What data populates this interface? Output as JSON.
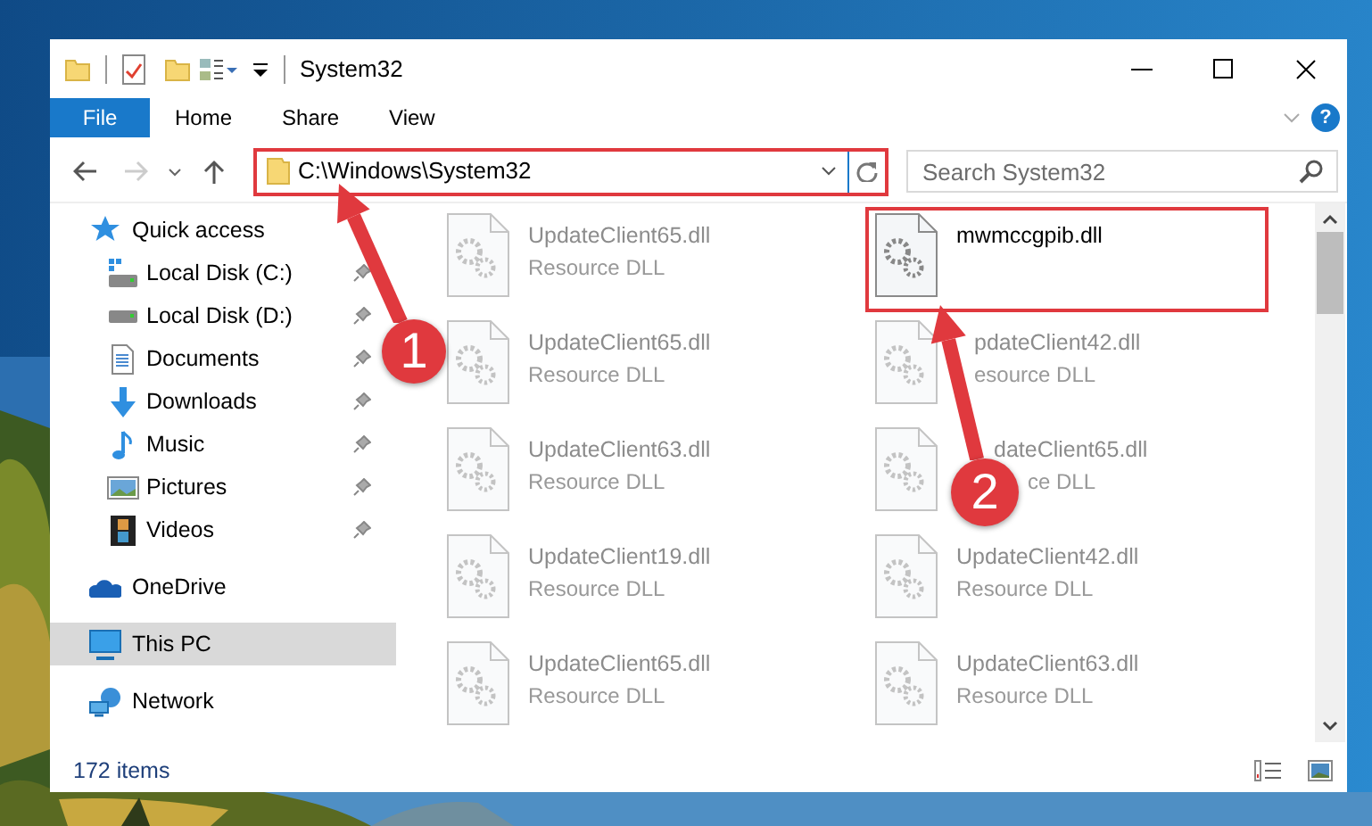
{
  "window": {
    "title": "System32"
  },
  "ribbon": {
    "file_button": "File",
    "tabs": [
      "Home",
      "Share",
      "View"
    ],
    "help": "?"
  },
  "navigation": {
    "back_enabled": true,
    "forward_enabled": false
  },
  "address_bar": {
    "path": "C:\\Windows\\System32",
    "highlighted": true
  },
  "search": {
    "placeholder": "Search System32"
  },
  "sidebar": {
    "items": [
      {
        "label": "Quick access",
        "kind": "star",
        "selected": false,
        "children": [
          {
            "label": "Local Disk (C:)",
            "kind": "system-drive",
            "pinned": true
          },
          {
            "label": "Local Disk (D:)",
            "kind": "drive",
            "pinned": true
          },
          {
            "label": "Documents",
            "kind": "documents",
            "pinned": true
          },
          {
            "label": "Downloads",
            "kind": "downloads",
            "pinned": true
          },
          {
            "label": "Music",
            "kind": "music",
            "pinned": true
          },
          {
            "label": "Pictures",
            "kind": "pictures",
            "pinned": true
          },
          {
            "label": "Videos",
            "kind": "videos",
            "pinned": true
          }
        ]
      },
      {
        "label": "OneDrive",
        "kind": "cloud",
        "selected": false
      },
      {
        "label": "This PC",
        "kind": "computer",
        "selected": true
      },
      {
        "label": "Network",
        "kind": "network",
        "selected": false
      }
    ]
  },
  "files": [
    {
      "name": "UpdateClient65.dll",
      "type": "Resource DLL",
      "blurred": true,
      "highlighted": false
    },
    {
      "name": "mwmccgpib.dll",
      "blurred": false,
      "highlighted": true
    },
    {
      "name": "UpdateClient65.dll",
      "type": "Resource DLL",
      "blurred": true,
      "highlighted": false
    },
    {
      "name": "pdateClient42.dll",
      "type": "esource DLL",
      "blurred": true,
      "highlighted": false,
      "kind": "under-arrow"
    },
    {
      "name": "UpdateClient63.dll",
      "type": "Resource DLL",
      "blurred": true,
      "highlighted": false
    },
    {
      "name": "dateClient65.dll",
      "type": "ce DLL",
      "blurred": true,
      "highlighted": false,
      "kind": "under-badge"
    },
    {
      "name": "UpdateClient19.dll",
      "type": "Resource DLL",
      "blurred": true,
      "highlighted": false
    },
    {
      "name": "UpdateClient42.dll",
      "type": "Resource DLL",
      "blurred": true,
      "highlighted": false
    },
    {
      "name": "UpdateClient65.dll",
      "type": "Resource DLL",
      "blurred": true,
      "highlighted": false
    },
    {
      "name": "UpdateClient63.dll",
      "type": "Resource DLL",
      "blurred": true,
      "highlighted": false
    }
  ],
  "status_bar": {
    "item_count": "172 items"
  },
  "annotations": [
    {
      "number": "1"
    },
    {
      "number": "2"
    }
  ]
}
